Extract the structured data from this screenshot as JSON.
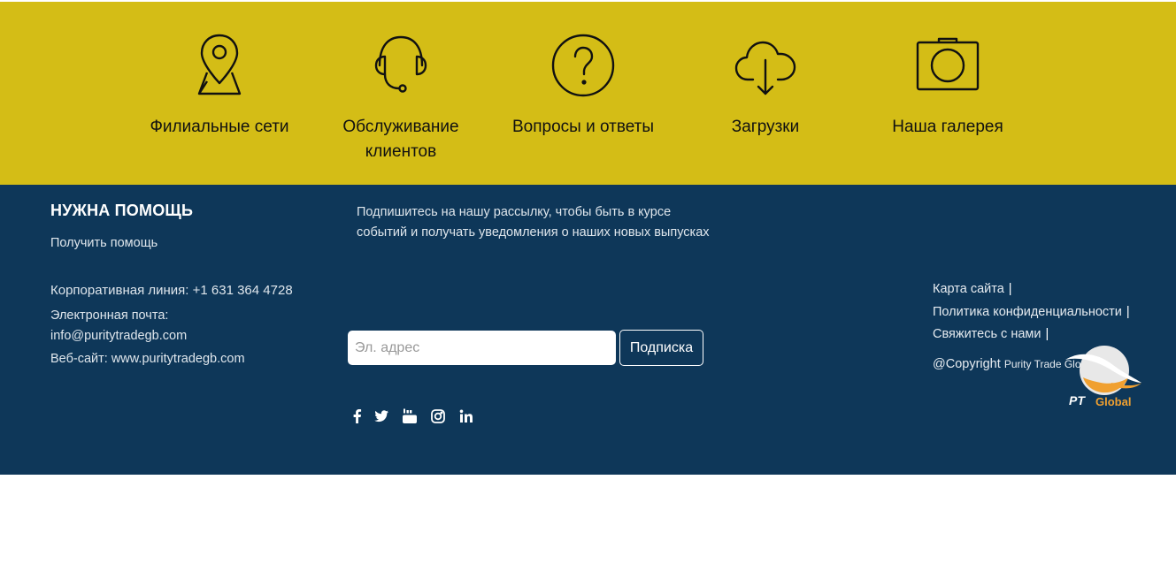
{
  "features": [
    {
      "label": "Филиальные сети",
      "icon": "map-pin-icon"
    },
    {
      "label": "Обслуживание клиентов",
      "icon": "headset-icon"
    },
    {
      "label": "Вопросы и ответы",
      "icon": "question-icon"
    },
    {
      "label": "Загрузки",
      "icon": "cloud-download-icon"
    },
    {
      "label": "Наша галерея",
      "icon": "camera-icon"
    }
  ],
  "help": {
    "title": "НУЖНА ПОМОЩЬ",
    "get_help": "Получить помощь",
    "corporate_line": "Корпоративная линия: +1 631 364 4728",
    "email_label": "Электронная почта:",
    "email": "info@puritytradegb.com",
    "website": "Веб-сайт: www.puritytradegb.com"
  },
  "newsletter": {
    "text": "Подпишитесь на нашу рассылку, чтобы быть в курсе событий и получать уведомления о наших новых выпусках",
    "email_placeholder": "Эл. адрес",
    "subscribe_label": "Подписка"
  },
  "social": [
    "facebook-icon",
    "twitter-icon",
    "youtube-icon",
    "instagram-icon",
    "linkedin-icon"
  ],
  "links": {
    "sitemap": "Карта сайта",
    "privacy": "Политика конфиденциальности",
    "contact": "Свяжитесь с нами",
    "separator": "|"
  },
  "copyright": {
    "prefix": "@Copyright",
    "company": "Purity Trade Global"
  },
  "logo": {
    "text_pt": "PT",
    "text_global": "Global"
  },
  "colors": {
    "top_band": "#d4bd16",
    "footer": "#0e3759",
    "logo_orange": "#f0a030"
  }
}
